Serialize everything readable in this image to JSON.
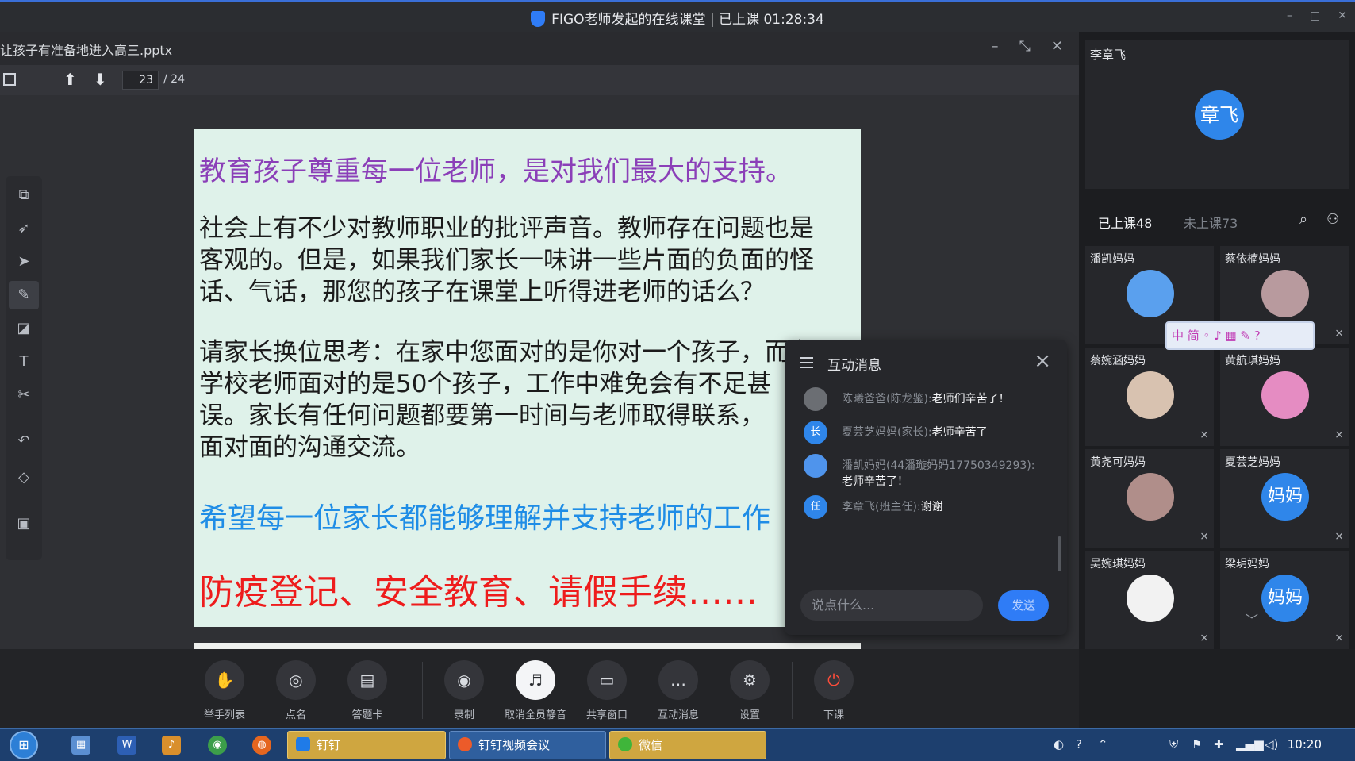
{
  "window": {
    "title": "FIGO老师发起的在线课堂 | 已上课 01:28:34",
    "minimize": "–",
    "maximize": "□",
    "close": "✕"
  },
  "document": {
    "filename": "让孩子有准备地进入高三.pptx",
    "page_current": "23",
    "page_total": "/ 24"
  },
  "slide": {
    "heading": "教育孩子尊重每一位老师，是对我们最大的支持。",
    "para1_l1": "社会上有不少对教师职业的批评声音。教师存在问题也是",
    "para1_l2": "客观的。但是，如果我们家长一味讲一些片面的负面的怪",
    "para1_l3": "话、气话，那您的孩子在课堂上听得进老师的话么？",
    "para2_l1": "请家长换位思考：在家中您面对的是你对一个孩子，而在",
    "para2_l2": "学校老师面对的是50个孩子，工作中难免会有不足甚",
    "para2_l3": "误。家长有任何问题都要第一时间与老师取得联系，",
    "para2_l4": "面对面的沟通交流。",
    "blue_line": "希望每一位家长都能够理解并支持老师的工作",
    "red_line": "防疫登记、安全教育、请假手续……"
  },
  "chat": {
    "title": "互动消息",
    "messages": [
      {
        "who": "陈曦爸爸(陈龙鉴):",
        "text": "老师们辛苦了！",
        "avatar": "",
        "avatar_color": "#6b6e73"
      },
      {
        "who": "夏芸芝妈妈(家长):",
        "text": "老师辛苦了",
        "avatar": "长",
        "avatar_color": "#2f86ea"
      },
      {
        "who": "潘凯妈妈(44潘璇妈妈17750349293):",
        "text": "老师辛苦了！",
        "avatar": "",
        "avatar_color": "#4f94ec"
      },
      {
        "who": "李章飞(班主任):",
        "text": "谢谢",
        "avatar": "任",
        "avatar_color": "#2f86ea"
      }
    ],
    "input_placeholder": "说点什么...",
    "send": "发送"
  },
  "teacher": {
    "name": "李章飞",
    "avatar": "章飞"
  },
  "tabs": {
    "in_class": "已上课48",
    "not_in_class": "未上课73"
  },
  "participants": [
    {
      "name": "潘凯妈妈",
      "avatar": "",
      "color": "#5aa0ee"
    },
    {
      "name": "蔡依楠妈妈",
      "avatar": "",
      "color": "#b89a9e"
    },
    {
      "name": "蔡婉涵妈妈",
      "avatar": "",
      "color": "#d8c2b0"
    },
    {
      "name": "黄航琪妈妈",
      "avatar": "",
      "color": "#e58cc2"
    },
    {
      "name": "黄尧可妈妈",
      "avatar": "",
      "color": "#b08e8a"
    },
    {
      "name": "夏芸芝妈妈",
      "avatar": "妈妈",
      "color": "#2f86ea"
    },
    {
      "name": "吴婉琪妈妈",
      "avatar": "",
      "color": "#f2f2f2"
    },
    {
      "name": "梁玥妈妈",
      "avatar": "妈妈",
      "color": "#2f86ea"
    }
  ],
  "ime_bar": "中 简 ◦ ♪ ▦ ✎ ?",
  "bottom": [
    {
      "label": "举手列表",
      "icon": "✋"
    },
    {
      "label": "点名",
      "icon": "◎"
    },
    {
      "label": "答题卡",
      "icon": "▤"
    },
    {
      "label": "录制",
      "icon": "◉"
    },
    {
      "label": "取消全员静音",
      "icon": "♬"
    },
    {
      "label": "共享窗口",
      "icon": "▭"
    },
    {
      "label": "互动消息",
      "icon": "…"
    },
    {
      "label": "设置",
      "icon": "⚙"
    },
    {
      "label": "下课",
      "icon": "⏻"
    }
  ],
  "taskbar": {
    "tasks": [
      "钉钉",
      "钉钉视频会议",
      "微信"
    ],
    "clock": "10:20"
  }
}
